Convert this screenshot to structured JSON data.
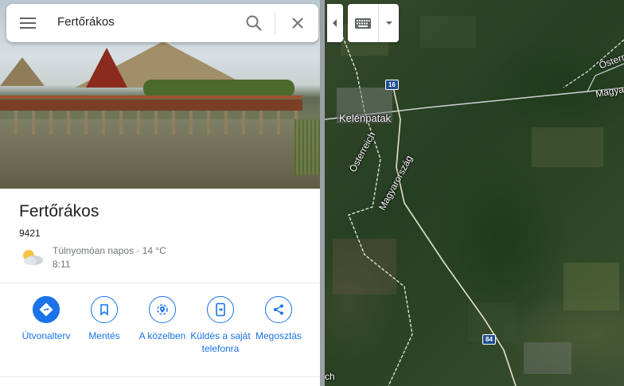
{
  "search": {
    "value": "Fertőrákos"
  },
  "place": {
    "title": "Fertőrákos",
    "postal_code": "9421",
    "weather": "Túlnyomóan napos · 14 °C",
    "local_time": "8:11"
  },
  "actions": [
    {
      "label": "Útvonalterv",
      "icon": "directions-icon"
    },
    {
      "label": "Mentés",
      "icon": "bookmark-icon"
    },
    {
      "label": "A közelben",
      "icon": "nearby-icon"
    },
    {
      "label": "Küldés a saját telefonra",
      "icon": "send-to-phone-icon"
    },
    {
      "label": "Megosztás",
      "icon": "share-icon"
    }
  ],
  "map": {
    "labels": {
      "town": "Kelénpatak",
      "border_at": "Österreich",
      "border_hu": "Magyarország",
      "top_right_at": "Österr",
      "top_right_hu": "Magya",
      "bottom_left": "ch"
    },
    "shields": {
      "road_16": "16",
      "road_84": "84"
    }
  },
  "colors": {
    "accent": "#1a73e8",
    "text": "#202124",
    "secondary_text": "#70757a"
  }
}
